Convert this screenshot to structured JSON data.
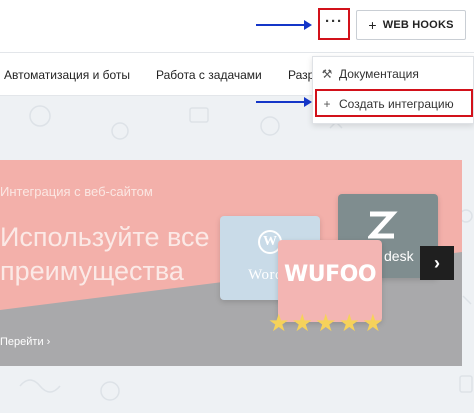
{
  "header": {
    "more_label": "···",
    "webhooks_label": "WEB HOOKS"
  },
  "nav": {
    "items": [
      "Автоматизация и боты",
      "Работа с задачами",
      "Разр"
    ]
  },
  "dropdown": {
    "items": [
      {
        "icon": "tools-icon",
        "label": "Документация"
      },
      {
        "icon": "plus-icon",
        "label": "Создать интеграцию"
      }
    ]
  },
  "banner": {
    "eyebrow": "Интеграция с веб-сайтом",
    "title": "Используйте все преимущества",
    "link": "Перейти ›",
    "cards": [
      "WORDPRESS",
      "zendesk",
      "WUFOO"
    ],
    "wp_visible": "WordP",
    "zd_visible": "desk",
    "rating_stars": 5,
    "next_label": "›"
  },
  "colors": {
    "highlight": "#d2111a",
    "arrow": "#1436c8",
    "banner_pink": "#f3b0aa",
    "banner_gray": "#a9a9ab",
    "star": "#f6d25a"
  }
}
